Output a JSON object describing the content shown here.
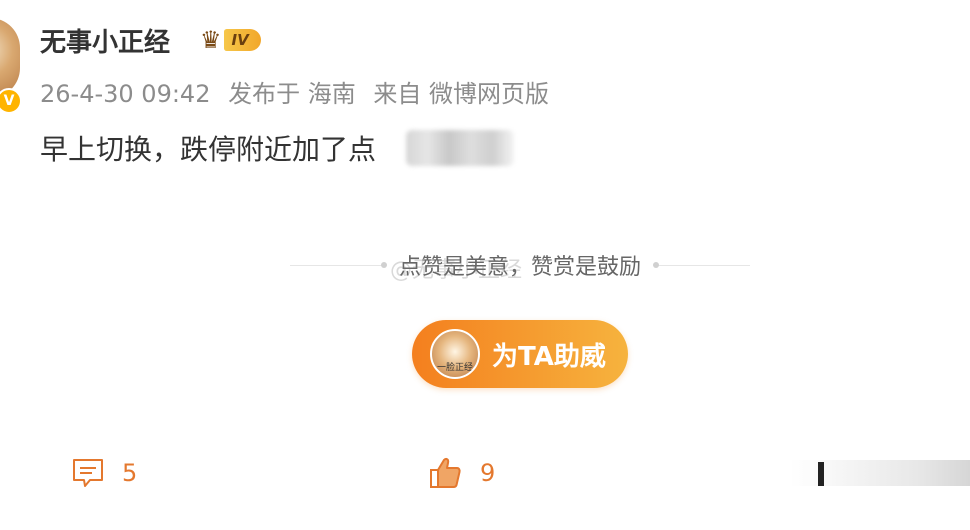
{
  "post": {
    "author": "无事小正经",
    "level_badge": "IV",
    "meta": {
      "time": "26-4-30 09:42",
      "location": "发布于 海南",
      "source": "来自 微博网页版"
    },
    "content": "早上切换，跌停附近加了点"
  },
  "reward": {
    "divider_text": "点赞是美意，赞赏是鼓励",
    "watermark": "@无事小正经",
    "cheer_button": "为TA助威",
    "cheer_avatar_caption": "一脸正经"
  },
  "actions": {
    "comments": "5",
    "likes": "9"
  },
  "colors": {
    "accent_orange": "#e4782e",
    "button_gradient_start": "#f47f1e",
    "button_gradient_end": "#f6b33e",
    "vip_badge": "#ffb400"
  }
}
